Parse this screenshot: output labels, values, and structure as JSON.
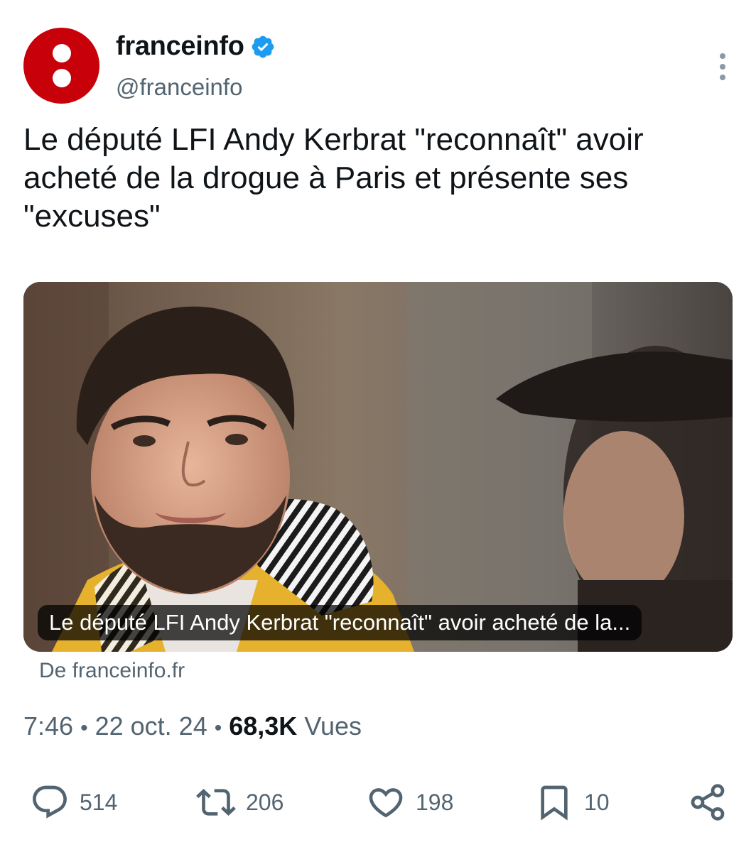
{
  "author": {
    "display_name": "franceinfo",
    "handle": "@franceinfo",
    "verified": true,
    "avatar_color": "#c8000a",
    "verified_color": "#1d9bf0"
  },
  "tweet": {
    "text": "Le député LFI Andy Kerbrat \"reconnaît\" avoir\nacheté de la drogue à Paris et présente ses\n\"excuses\""
  },
  "card": {
    "caption": "Le député LFI Andy Kerbrat \"reconnaît\" avoir acheté de la...",
    "source": "De franceinfo.fr"
  },
  "meta": {
    "time": "7:46",
    "separator": "•",
    "date": "22 oct. 24",
    "views_count": "68,3K",
    "views_label": "Vues"
  },
  "actions": {
    "replies": "514",
    "reposts": "206",
    "likes": "198",
    "bookmarks": "10"
  },
  "icons": [
    "more-vertical-icon",
    "reply-icon",
    "retweet-icon",
    "like-icon",
    "bookmark-icon",
    "share-icon",
    "verified-badge-icon"
  ]
}
